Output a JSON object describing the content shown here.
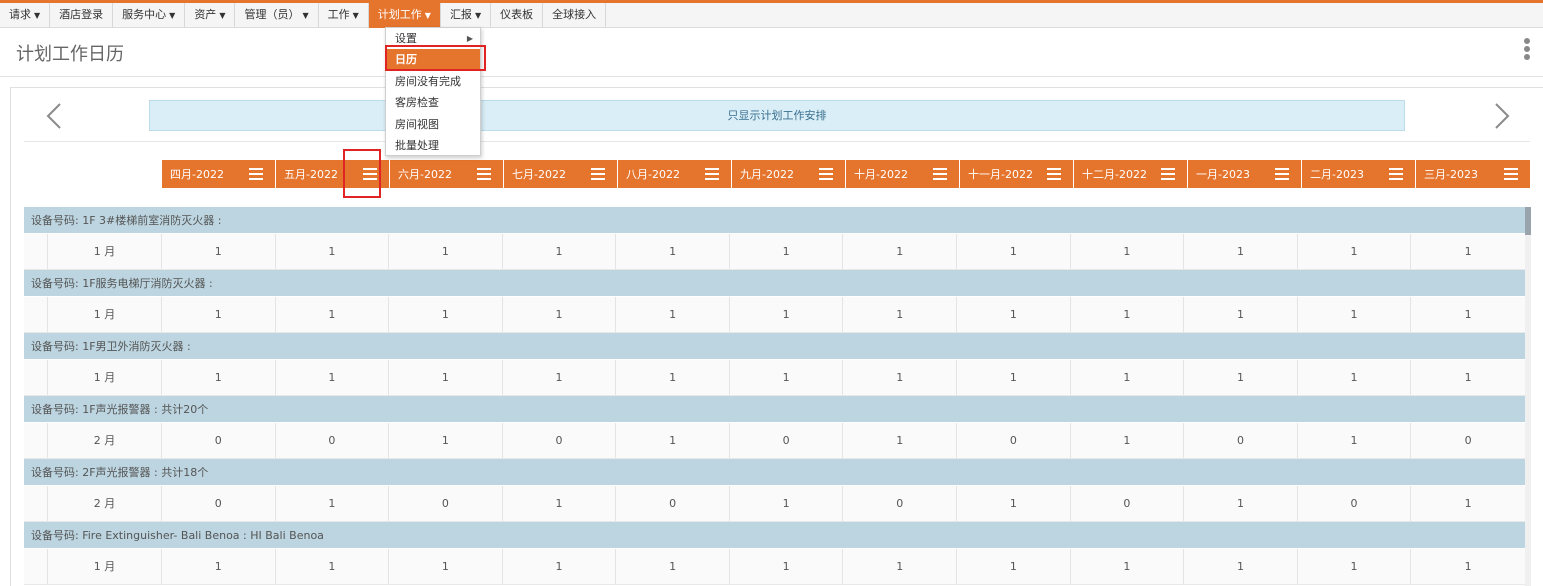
{
  "nav": {
    "items": [
      {
        "label": "请求",
        "caret": "▼"
      },
      {
        "label": "酒店登录",
        "caret": ""
      },
      {
        "label": "服务中心",
        "caret": "▼"
      },
      {
        "label": "资产",
        "caret": "▼"
      },
      {
        "label": "管理（员）",
        "caret": "▼"
      },
      {
        "label": "工作",
        "caret": "▼"
      },
      {
        "label": "计划工作",
        "caret": "▼",
        "active": true
      },
      {
        "label": "汇报",
        "caret": "▼"
      },
      {
        "label": "仪表板",
        "caret": ""
      },
      {
        "label": "全球接入",
        "caret": ""
      }
    ]
  },
  "dropdown": {
    "items": [
      {
        "label": "设置",
        "submenu": "▶"
      },
      {
        "label": "日历",
        "submenu": "",
        "selected": true
      },
      {
        "label": "房间没有完成",
        "submenu": ""
      },
      {
        "label": "客房检查",
        "submenu": ""
      },
      {
        "label": "房间视图",
        "submenu": ""
      },
      {
        "label": "批量处理",
        "submenu": ""
      }
    ]
  },
  "page": {
    "title": "计划工作日历",
    "banner": "只显示计划工作安排"
  },
  "months": [
    "四月-2022",
    "五月-2022",
    "六月-2022",
    "七月-2022",
    "八月-2022",
    "九月-2022",
    "十月-2022",
    "十一月-2022",
    "十二月-2022",
    "一月-2023",
    "二月-2023",
    "三月-2023"
  ],
  "equipment": [
    {
      "header": "设备号码: 1F 3#楼梯前室消防灭火器 :",
      "freq": "1 月",
      "values": [
        "1",
        "1",
        "1",
        "1",
        "1",
        "1",
        "1",
        "1",
        "1",
        "1",
        "1",
        "1"
      ]
    },
    {
      "header": "设备号码: 1F服务电梯厅消防灭火器 :",
      "freq": "1 月",
      "values": [
        "1",
        "1",
        "1",
        "1",
        "1",
        "1",
        "1",
        "1",
        "1",
        "1",
        "1",
        "1"
      ]
    },
    {
      "header": "设备号码: 1F男卫外消防灭火器 :",
      "freq": "1 月",
      "values": [
        "1",
        "1",
        "1",
        "1",
        "1",
        "1",
        "1",
        "1",
        "1",
        "1",
        "1",
        "1"
      ]
    },
    {
      "header": "设备号码: 1F声光报警器 : 共计20个",
      "freq": "2 月",
      "values": [
        "0",
        "0",
        "1",
        "0",
        "1",
        "0",
        "1",
        "0",
        "1",
        "0",
        "1",
        "0"
      ]
    },
    {
      "header": "设备号码: 2F声光报警器 : 共计18个",
      "freq": "2 月",
      "values": [
        "0",
        "1",
        "0",
        "1",
        "0",
        "1",
        "0",
        "1",
        "0",
        "1",
        "0",
        "1"
      ]
    },
    {
      "header": "设备号码: Fire Extinguisher- Bali Benoa : HI Bali Benoa",
      "freq": "1 月",
      "values": [
        "1",
        "1",
        "1",
        "1",
        "1",
        "1",
        "1",
        "1",
        "1",
        "1",
        "1",
        "1"
      ]
    }
  ],
  "colors": {
    "accent": "#e5742d",
    "row_header": "#bcd5e0",
    "banner": "#d9eef7",
    "highlight": "#e02424"
  },
  "icons": {
    "prev": "chevron-left-icon",
    "next": "chevron-right-icon",
    "month_menu": "hamburger-menu-icon",
    "more": "kebab-menu-icon"
  }
}
